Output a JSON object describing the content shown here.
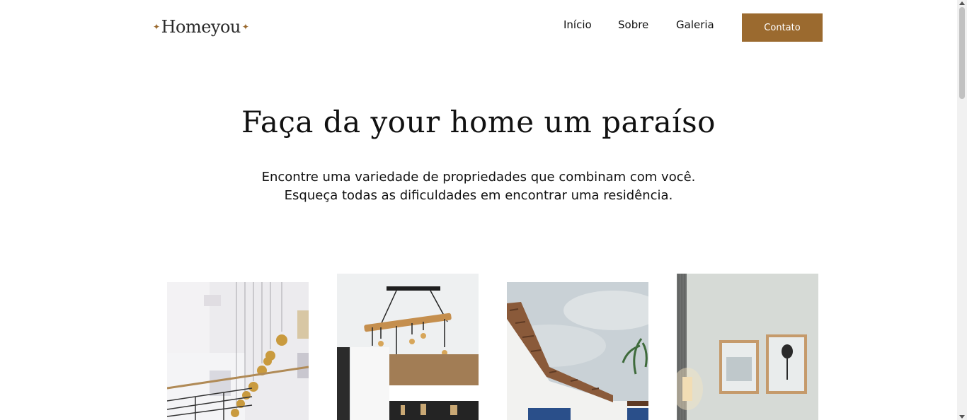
{
  "brand": {
    "name": "Homeyou",
    "star_left": "✦",
    "star_right": "✦",
    "accent_color": "#9b6a2f"
  },
  "nav": {
    "items": [
      {
        "label": "Início"
      },
      {
        "label": "Sobre"
      },
      {
        "label": "Galeria"
      }
    ],
    "contact_label": "Contato"
  },
  "hero": {
    "title": "Faça da your home um paraíso",
    "subtitle_line1": "Encontre uma variedade de propriedades que combinam com você.",
    "subtitle_line2": "Esqueça todas as dificuldades em encontrar uma residência."
  },
  "gallery": {
    "images": [
      {
        "icon": "stairway-pendant-lights-image"
      },
      {
        "icon": "kitchen-pendant-lamp-image"
      },
      {
        "icon": "house-roof-palm-image"
      },
      {
        "icon": "living-room-frames-image"
      }
    ]
  }
}
